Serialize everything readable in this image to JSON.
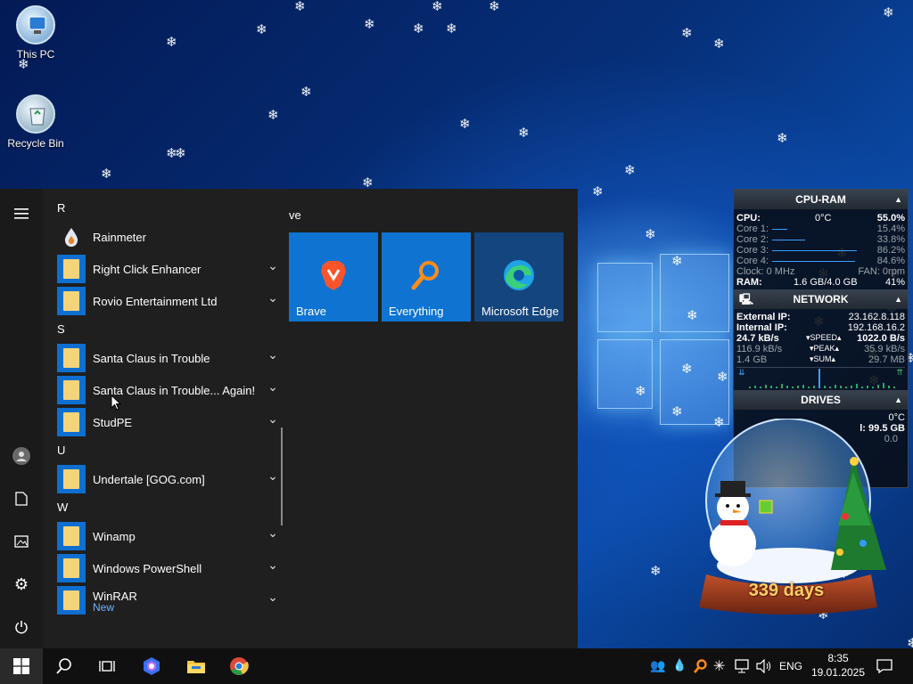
{
  "desktop": {
    "icons": [
      {
        "label": "This PC",
        "icon": "this-pc-icon"
      },
      {
        "label": "Recycle Bin",
        "icon": "recycle-bin-icon"
      }
    ]
  },
  "start_menu": {
    "groups": [
      {
        "letter": "R",
        "apps": [
          {
            "label": "Rainmeter",
            "icon": "rainmeter-icon",
            "expandable": false
          },
          {
            "label": "Right Click Enhancer",
            "icon": "folder-icon",
            "expandable": true
          },
          {
            "label": "Rovio Entertainment Ltd",
            "icon": "folder-icon",
            "expandable": true
          }
        ]
      },
      {
        "letter": "S",
        "apps": [
          {
            "label": "Santa Claus in Trouble",
            "icon": "folder-icon",
            "expandable": true
          },
          {
            "label": "Santa Claus in Trouble... Again!",
            "icon": "folder-icon",
            "expandable": true
          },
          {
            "label": "StudPE",
            "icon": "folder-icon",
            "expandable": true
          }
        ]
      },
      {
        "letter": "U",
        "apps": [
          {
            "label": "Undertale [GOG.com]",
            "icon": "folder-icon",
            "expandable": true
          }
        ]
      },
      {
        "letter": "W",
        "apps": [
          {
            "label": "Winamp",
            "icon": "folder-icon",
            "expandable": true
          },
          {
            "label": "Windows PowerShell",
            "icon": "folder-icon",
            "expandable": true
          },
          {
            "label": "WinRAR",
            "sub": "New",
            "icon": "folder-icon",
            "expandable": true
          }
        ]
      }
    ],
    "tiles_header": "ve",
    "tiles": [
      {
        "label": "Brave",
        "icon": "brave-icon"
      },
      {
        "label": "Everything",
        "icon": "everything-search-icon"
      },
      {
        "label": "Microsoft Edge",
        "icon": "edge-icon"
      }
    ],
    "rail": [
      "hamburger-menu-icon",
      "user-avatar-icon",
      "documents-icon",
      "pictures-icon",
      "settings-gear-icon",
      "power-icon"
    ]
  },
  "rainmeter": {
    "cpu_ram": {
      "title": "CPU-RAM",
      "cpu_label": "CPU:",
      "temp": "0°C",
      "cpu_total": "55.0%",
      "cores": [
        {
          "label": "Core 1:",
          "value": "15.4%",
          "load": 0.154
        },
        {
          "label": "Core 2:",
          "value": "33.8%",
          "load": 0.338
        },
        {
          "label": "Core 3:",
          "value": "86.2%",
          "load": 0.862
        },
        {
          "label": "Core 4:",
          "value": "84.6%",
          "load": 0.846
        }
      ],
      "clock": "Clock: 0 MHz",
      "fan": "FAN: 0rpm",
      "ram_label": "RAM:",
      "ram_value": "1.6 GB/4.0 GB",
      "ram_pct": "41%"
    },
    "network": {
      "title": "NETWORK",
      "external_label": "External IP:",
      "external_ip": "23.162.8.118",
      "internal_label": "Internal IP:",
      "internal_ip": "192.168.16.2",
      "down_speed": "24.7 kB/s",
      "speed_label": "SPEED",
      "up_speed": "1022.0 B/s",
      "down_peak": "116.9 kB/s",
      "peak_label": "PEAK",
      "up_peak": "35.9 kB/s",
      "down_sum": "1.4 GB",
      "sum_label": "SUM",
      "up_sum": "29.7 MB"
    },
    "drives": {
      "title": "DRIVES",
      "temp": "0°C",
      "free_partial": "l: 99.5 GB",
      "partial2": "0.0"
    }
  },
  "widget": {
    "days_text": "339 days"
  },
  "taskbar": {
    "start_icon": "windows-start-icon",
    "pinned": [
      "search-icon",
      "task-view-icon",
      "copilot-icon",
      "file-explorer-icon",
      "chrome-icon"
    ],
    "tray_icons": [
      "people-icon",
      "rainmeter-tray-icon",
      "everything-tray-icon",
      "snowflake-icon",
      "network-icon",
      "volume-icon"
    ],
    "language": "ENG",
    "time": "8:35",
    "date": "19.01.2025",
    "notification_icon": "notification-center-icon"
  },
  "colors": {
    "accent": "#0f73d2",
    "folder": "#f4d47b",
    "start_bg": "#1f1f1f",
    "taskbar_bg": "#101010",
    "sub_link": "#6fb4ff"
  }
}
